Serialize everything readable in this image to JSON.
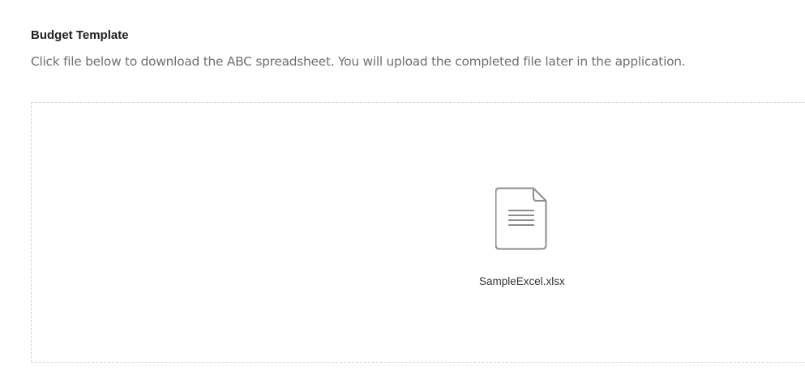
{
  "section": {
    "title": "Budget Template",
    "description": "Click file below to download the ABC spreadsheet. You will upload the completed file later in the application."
  },
  "file": {
    "name": "SampleExcel.xlsx",
    "icon": "document-icon"
  },
  "colors": {
    "icon_stroke": "#8c8c8c",
    "dropzone_border": "#d0d0d0",
    "description_text": "#6f6f6f"
  }
}
